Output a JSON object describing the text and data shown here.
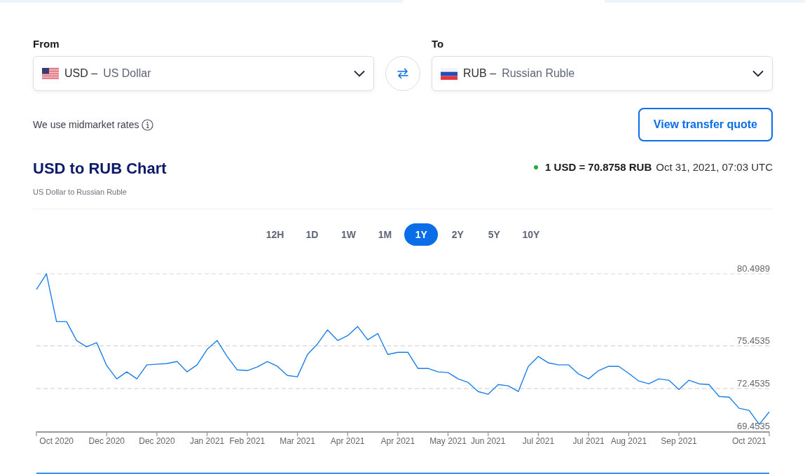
{
  "from": {
    "label": "From",
    "kind": "us",
    "code": "USD –",
    "name": "US Dollar"
  },
  "to": {
    "label": "To",
    "kind": "ru",
    "code": "RUB –",
    "name": "Russian Ruble"
  },
  "rates_note": "We use midmarket rates",
  "quote_button": "View transfer quote",
  "chart_title": "USD to RUB Chart",
  "chart_subtitle": "US Dollar to Russian Ruble",
  "rate": {
    "live": true,
    "text": "1 USD = 70.8758 RUB",
    "time": "Oct 31, 2021, 07:03 UTC"
  },
  "periods": [
    {
      "label": "12H",
      "selected": false
    },
    {
      "label": "1D",
      "selected": false
    },
    {
      "label": "1W",
      "selected": false
    },
    {
      "label": "1M",
      "selected": false
    },
    {
      "label": "1Y",
      "selected": true
    },
    {
      "label": "2Y",
      "selected": false
    },
    {
      "label": "5Y",
      "selected": false
    },
    {
      "label": "10Y",
      "selected": false
    }
  ],
  "chart": {
    "chart_data": {
      "type": "line",
      "ylim": [
        69.4535,
        80.4989
      ],
      "categories": [
        null,
        null,
        "Oct 2020",
        null,
        null,
        null,
        null,
        "Dec 2020",
        null,
        null,
        null,
        null,
        "Dec 2020",
        null,
        null,
        null,
        null,
        "Jan 2021",
        null,
        null,
        null,
        "Feb 2021",
        null,
        null,
        null,
        null,
        "Mar 2021",
        null,
        null,
        null,
        null,
        "Apr 2021",
        null,
        null,
        null,
        null,
        "Apr 2021",
        null,
        null,
        null,
        null,
        "May 2021",
        null,
        null,
        null,
        "Jun 2021",
        null,
        null,
        null,
        null,
        "Jul 2021",
        null,
        null,
        null,
        null,
        "Jul 2021",
        null,
        null,
        null,
        "Aug 2021",
        null,
        null,
        null,
        null,
        "Sep 2021",
        null,
        null,
        null,
        null,
        null,
        null,
        "Oct 2021",
        null,
        null
      ],
      "series": [
        {
          "color": "#1a7fe8",
          "values": [
            79.4,
            80.49,
            77.14,
            77.14,
            75.82,
            75.38,
            75.67,
            74.06,
            73.13,
            73.62,
            73.13,
            74.11,
            74.16,
            74.2,
            74.35,
            73.62,
            74.11,
            75.19,
            75.82,
            74.7,
            73.76,
            73.71,
            73.96,
            74.35,
            74.01,
            73.37,
            73.28,
            74.84,
            75.58,
            76.56,
            75.82,
            76.16,
            76.8,
            75.87,
            76.31,
            74.84,
            74.99,
            74.99,
            73.86,
            73.86,
            73.62,
            73.57,
            73.13,
            72.88,
            72.24,
            72.05,
            72.73,
            72.64,
            72.24,
            74.01,
            74.7,
            74.25,
            74.11,
            74.11,
            73.47,
            73.13,
            73.71,
            74.01,
            74.01,
            73.52,
            72.98,
            72.78,
            73.13,
            73.03,
            72.39,
            73.03,
            72.78,
            72.73,
            71.9,
            71.85,
            71.07,
            70.92,
            69.94,
            70.82
          ]
        }
      ],
      "yticks": [
        {
          "value": 80.4989,
          "label": "80.4989"
        },
        {
          "value": 75.4535,
          "label": "75.4535"
        },
        {
          "value": 72.4535,
          "label": "72.4535"
        },
        {
          "value": 69.4535,
          "label": "69.4535"
        }
      ]
    }
  }
}
